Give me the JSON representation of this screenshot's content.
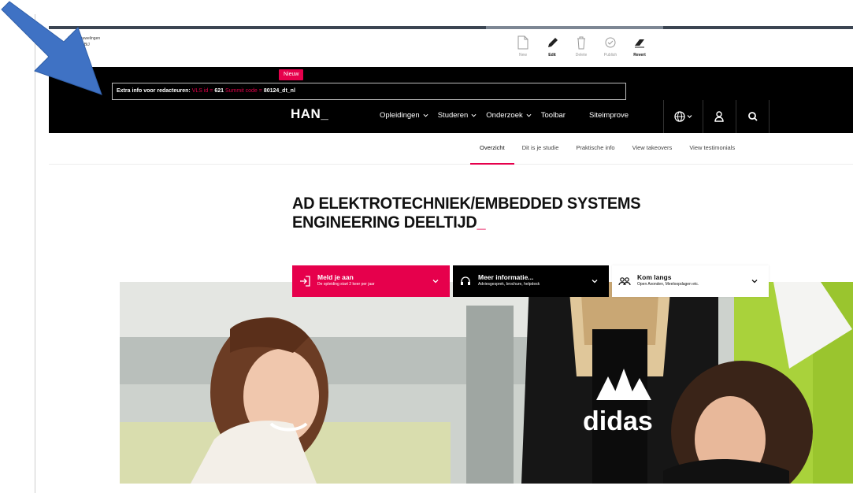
{
  "cms": {
    "user_lines": [
      "t van Houwelingen",
      "tal_mg. ABiJ"
    ],
    "tools": [
      {
        "icon": "document-icon",
        "label": "New",
        "active": false
      },
      {
        "icon": "pencil-icon",
        "label": "Edit",
        "active": true
      },
      {
        "icon": "trash-icon",
        "label": "Delete",
        "active": false
      },
      {
        "icon": "check-circle-icon",
        "label": "Publish",
        "active": false
      },
      {
        "icon": "eraser-icon",
        "label": "Revert",
        "active": true
      }
    ]
  },
  "header": {
    "badge": "Nieuw",
    "info": {
      "prefix": "Extra info voor redacteuren:",
      "vls_label": "VLS id =",
      "vls_value": "621",
      "summit_label": "Summit code =",
      "summit_value": "80124_dt_nl"
    },
    "logo": "HAN_",
    "nav": [
      {
        "label": "Opleidingen",
        "dropdown": true
      },
      {
        "label": "Studeren",
        "dropdown": true
      },
      {
        "label": "Onderzoek",
        "dropdown": true
      },
      {
        "label": "Toolbar",
        "dropdown": false
      },
      {
        "label": "Siteimprove",
        "dropdown": false
      }
    ]
  },
  "subnav": {
    "items": [
      "Overzicht",
      "Dit is je studie",
      "Praktische info",
      "View takeovers",
      "View testimonials"
    ],
    "active_index": 0
  },
  "page": {
    "title_line1": "AD ELEKTROTECHNIEK/EMBEDDED SYSTEMS",
    "title_line2": "ENGINEERING DEELTIJD",
    "title_cursor": "_"
  },
  "cta": {
    "apply": {
      "title": "Meld je aan",
      "subtitle": "De opleiding start 2 keer per jaar"
    },
    "info": {
      "title": "Meer informatie...",
      "subtitle": "Adviesgesprek, brochure, helpdesk"
    },
    "visit": {
      "title": "Kom langs",
      "subtitle": "Open Avonden, Meeloopdagen etc."
    }
  },
  "hero": {
    "shirt_text": "didas"
  },
  "colors": {
    "brand": "#e6004c",
    "header_bg": "#000000",
    "arrow": "#3f72c4"
  }
}
